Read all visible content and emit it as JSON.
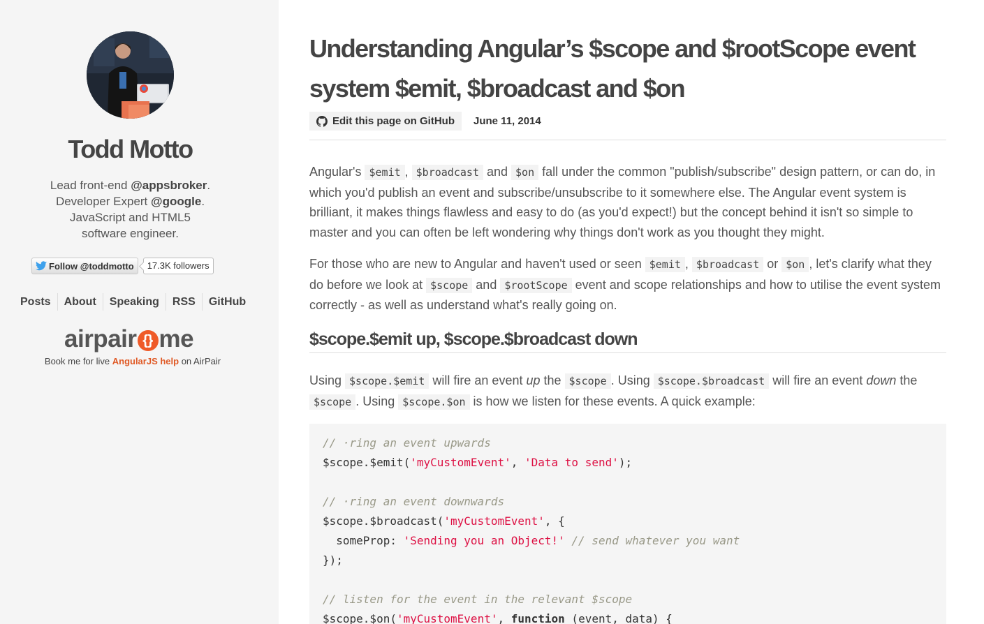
{
  "sidebar": {
    "author_name": "Todd Motto",
    "bio": {
      "line1_prefix": "Lead front-end ",
      "line1_handle": "@appsbroker",
      "line1_suffix": ".",
      "line2_prefix": "Developer Expert ",
      "line2_handle": "@google",
      "line2_suffix": ".",
      "line3": "JavaScript and HTML5",
      "line4": "software engineer."
    },
    "follow_label": "Follow @toddmotto",
    "followers_count": "17.3K followers",
    "nav": [
      "Posts",
      "About",
      "Speaking",
      "RSS",
      "GitHub"
    ],
    "airpair": {
      "logo_left": "airpair",
      "logo_mark": "{}",
      "logo_right": "me",
      "tag_prefix": "Book me for live ",
      "tag_link": "AngularJS help",
      "tag_suffix": " on AirPair"
    },
    "accent_color": "#e05a26"
  },
  "post": {
    "title": "Understanding Angular’s $scope and $rootScope event system $emit, $broadcast and $on",
    "edit_label": "Edit this page on GitHub",
    "date": "June 11, 2014",
    "para1": {
      "t1": "Angular's ",
      "c1": "$emit",
      "t2": ", ",
      "c2": "$broadcast",
      "t3": " and ",
      "c3": "$on",
      "t4": " fall under the common \"publish/subscribe\" design pattern, or can do, in which you'd publish an event and subscribe/unsubscribe to it somewhere else. The Angular event system is brilliant, it makes things flawless and easy to do (as you'd expect!) but the concept behind it isn't so simple to master and you can often be left wondering why things don't work as you thought they might."
    },
    "para2": {
      "t1": "For those who are new to Angular and haven't used or seen ",
      "c1": "$emit",
      "t2": ", ",
      "c2": "$broadcast",
      "t3": " or ",
      "c3": "$on",
      "t4": ", let's clarify what they do before we look at ",
      "c4": "$scope",
      "t5": " and ",
      "c5": "$rootScope",
      "t6": " event and scope relationships and how to utilise the event system correctly - as well as understand what's really going on."
    },
    "section_title": "$scope.$emit up, $scope.$broadcast down",
    "para3": {
      "t1": "Using ",
      "c1": "$scope.$emit",
      "t2": " will fire an event ",
      "e1": "up",
      "t3": " the ",
      "c2": "$scope",
      "t4": ". Using ",
      "c3": "$scope.$broadcast",
      "t5": " will fire an event ",
      "e2": "down",
      "t6": " the ",
      "c4": "$scope",
      "t7": ". Using ",
      "c5": "$scope.$on",
      "t8": " is how we listen for these events. A quick example:"
    },
    "code": {
      "l1_comment": "// ·ring an event upwards",
      "l2_a": "$scope.$emit(",
      "l2_s1": "'myCustomEvent'",
      "l2_b": ", ",
      "l2_s2": "'Data to send'",
      "l2_c": ");",
      "l4_comment": "// ·ring an event downwards",
      "l5_a": "$scope.$broadcast(",
      "l5_s1": "'myCustomEvent'",
      "l5_b": ", {",
      "l6_a": "  someProp: ",
      "l6_s1": "'Sending you an Object!'",
      "l6_comment": " // send whatever you want",
      "l7": "});",
      "l9_comment": "// listen for the event in the relevant $scope",
      "l10_a": "$scope.$on(",
      "l10_s1": "'myCustomEvent'",
      "l10_b": ", ",
      "l10_kw": "function",
      "l10_c": " (event, data) {"
    }
  }
}
